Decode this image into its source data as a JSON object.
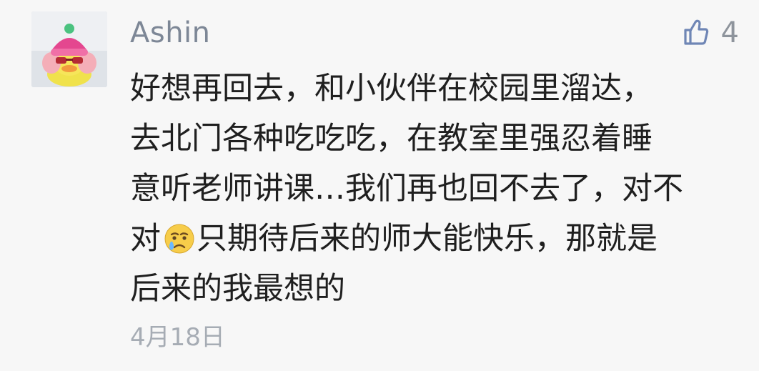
{
  "comment": {
    "author": "Ashin",
    "like_count": "4",
    "text_before_emoji": "好想再回去，和小伙伴在校园里溜达，\n去北门各种吃吃吃，在教室里强忍着睡\n意听老师讲课…我们再也回不去了，对不\n对",
    "emoji": "crying-face",
    "text_after_emoji": "只期待后来的师大能快乐，那就是\n后来的我最想的",
    "date": "4月18日"
  },
  "colors": {
    "background": "#f7f7f7",
    "author": "#7d8796",
    "like_icon": "#6f86b5",
    "timestamp": "#a6acb4",
    "text": "#1f1f1f"
  },
  "icons": {
    "like": "thumbs-up-icon",
    "avatar": "duck-avatar"
  }
}
